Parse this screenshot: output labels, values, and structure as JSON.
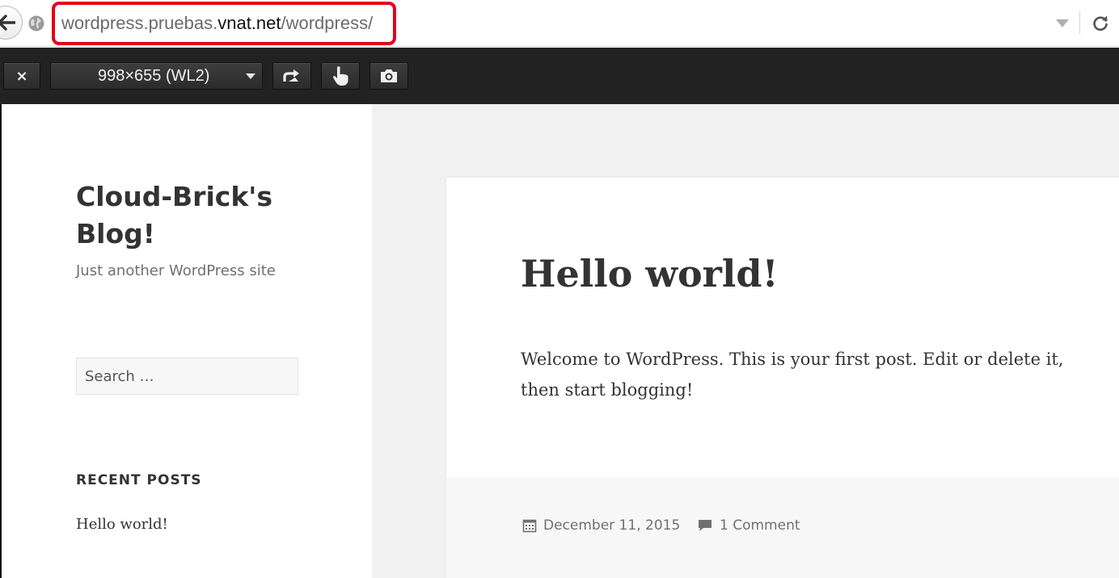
{
  "browser": {
    "url_prefix": "wordpress.pruebas.",
    "url_domain": "vnat.net",
    "url_suffix": "/wordpress/"
  },
  "rdm_toolbar": {
    "close_label": "×",
    "size_label": "998×655 (WL2)"
  },
  "sidebar": {
    "site_title": "Cloud-Brick's Blog!",
    "tagline": "Just another WordPress site",
    "search_placeholder": "Search …",
    "recent_posts_heading": "RECENT POSTS",
    "recent_posts": [
      "Hello world!"
    ]
  },
  "post": {
    "title": "Hello world!",
    "body": "Welcome to WordPress. This is your first post. Edit or delete it, then start blogging!",
    "date": "December 11, 2015",
    "comments": "1 Comment"
  },
  "colors": {
    "url_highlight": "#e3001b",
    "toolbar_bg": "#222222",
    "page_bg": "#f1f1f1",
    "text": "#333333"
  }
}
